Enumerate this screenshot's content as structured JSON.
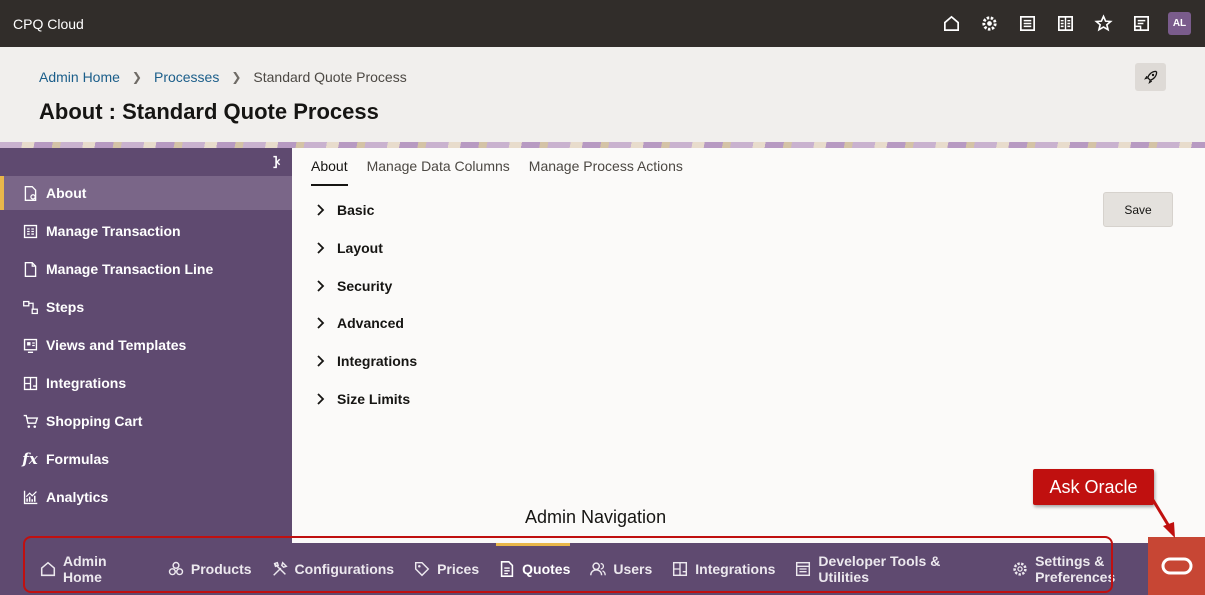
{
  "app": {
    "title": "CPQ Cloud"
  },
  "topbar": {
    "icons": [
      "home-icon",
      "gear-icon",
      "list-icon",
      "grid-list-icon",
      "star-icon",
      "document-icon"
    ],
    "avatar": "AL"
  },
  "breadcrumb": {
    "items": [
      {
        "label": "Admin Home"
      },
      {
        "label": "Processes"
      },
      {
        "label": "Standard Quote Process"
      }
    ]
  },
  "page": {
    "title": "About : Standard Quote Process"
  },
  "sidebar": {
    "items": [
      {
        "label": "About",
        "icon": "document-gear-icon",
        "active": true
      },
      {
        "label": "Manage Transaction",
        "icon": "form-icon"
      },
      {
        "label": "Manage Transaction Line",
        "icon": "document-icon"
      },
      {
        "label": "Steps",
        "icon": "steps-icon"
      },
      {
        "label": "Views and Templates",
        "icon": "template-icon"
      },
      {
        "label": "Integrations",
        "icon": "integrations-icon"
      },
      {
        "label": "Shopping Cart",
        "icon": "cart-icon"
      },
      {
        "label": "Formulas",
        "icon": "fx-icon"
      },
      {
        "label": "Analytics",
        "icon": "chart-icon"
      }
    ]
  },
  "main": {
    "tabs": [
      {
        "label": "About",
        "active": true
      },
      {
        "label": "Manage Data Columns"
      },
      {
        "label": "Manage Process Actions"
      }
    ],
    "sections": [
      {
        "label": "Basic"
      },
      {
        "label": "Layout"
      },
      {
        "label": "Security"
      },
      {
        "label": "Advanced"
      },
      {
        "label": "Integrations"
      },
      {
        "label": "Size Limits"
      }
    ],
    "save_label": "Save"
  },
  "bottomnav": {
    "items": [
      {
        "label": "Admin Home",
        "icon": "home-icon"
      },
      {
        "label": "Products",
        "icon": "products-icon"
      },
      {
        "label": "Configurations",
        "icon": "tools-icon"
      },
      {
        "label": "Prices",
        "icon": "price-tag-icon"
      },
      {
        "label": "Quotes",
        "icon": "quote-document-icon",
        "active": true
      },
      {
        "label": "Users",
        "icon": "users-icon"
      },
      {
        "label": "Integrations",
        "icon": "integrations-icon"
      },
      {
        "label": "Developer Tools & Utilities",
        "icon": "developer-tools-icon"
      },
      {
        "label": "Settings & Preferences",
        "icon": "gear-icon"
      }
    ]
  },
  "annotations": {
    "nav_label": "Admin Navigation",
    "callout": "Ask Oracle"
  },
  "colors": {
    "topbar": "#312d2a",
    "sidebar": "#5f4a70",
    "accent": "#e9b74a",
    "annotation": "#c0100f",
    "oracle": "#c74634"
  }
}
